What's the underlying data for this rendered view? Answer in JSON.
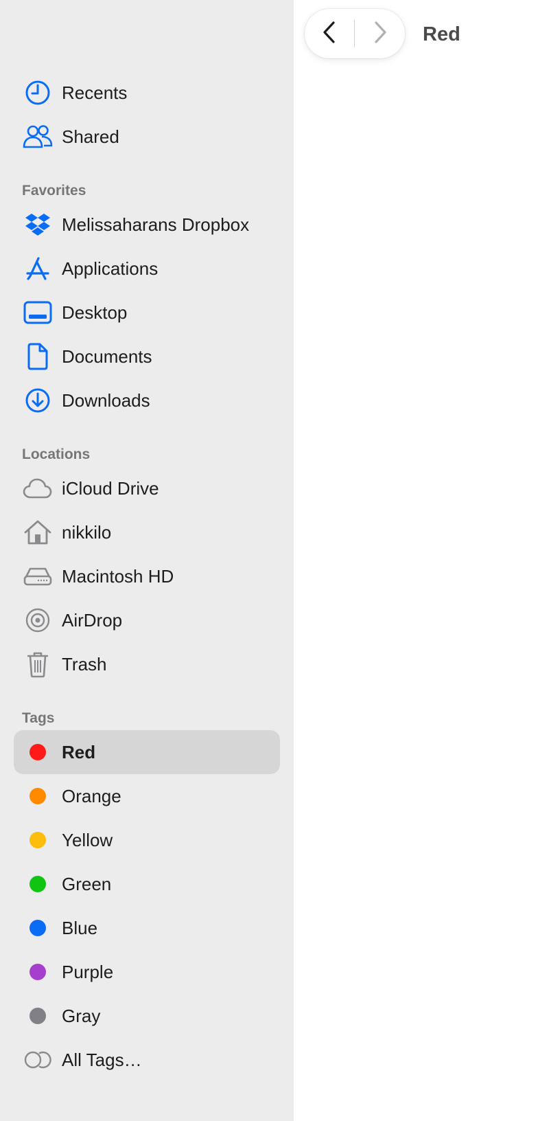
{
  "window": {
    "title": "Red"
  },
  "sidebar": {
    "top_items": [
      {
        "label": "Recents",
        "icon": "clock-icon"
      },
      {
        "label": "Shared",
        "icon": "shared-people-icon"
      }
    ],
    "sections": {
      "favorites": {
        "header": "Favorites",
        "items": [
          {
            "label": "Melissaharans Dropbox",
            "icon": "dropbox-icon"
          },
          {
            "label": "Applications",
            "icon": "applications-icon"
          },
          {
            "label": "Desktop",
            "icon": "desktop-icon"
          },
          {
            "label": "Documents",
            "icon": "document-icon"
          },
          {
            "label": "Downloads",
            "icon": "download-icon"
          }
        ]
      },
      "locations": {
        "header": "Locations",
        "items": [
          {
            "label": "iCloud Drive",
            "icon": "cloud-icon"
          },
          {
            "label": "nikkilo",
            "icon": "home-icon"
          },
          {
            "label": "Macintosh HD",
            "icon": "hard-drive-icon"
          },
          {
            "label": "AirDrop",
            "icon": "airdrop-icon"
          },
          {
            "label": "Trash",
            "icon": "trash-icon"
          }
        ]
      },
      "tags": {
        "header": "Tags",
        "items": [
          {
            "label": "Red",
            "color": "#ff1a1a",
            "selected": true
          },
          {
            "label": "Orange",
            "color": "#ff8a00"
          },
          {
            "label": "Yellow",
            "color": "#fcbd0c"
          },
          {
            "label": "Green",
            "color": "#12c412"
          },
          {
            "label": "Blue",
            "color": "#0a6cf5"
          },
          {
            "label": "Purple",
            "color": "#a63fce"
          },
          {
            "label": "Gray",
            "color": "#808086"
          },
          {
            "label": "All Tags…",
            "icon": "all-tags-icon"
          }
        ]
      }
    }
  },
  "colors": {
    "sidebar_bg": "#ececec",
    "accent_blue": "#0a6cf5",
    "icon_gray": "#8a8a8e",
    "selection_bg": "#d6d6d6"
  }
}
